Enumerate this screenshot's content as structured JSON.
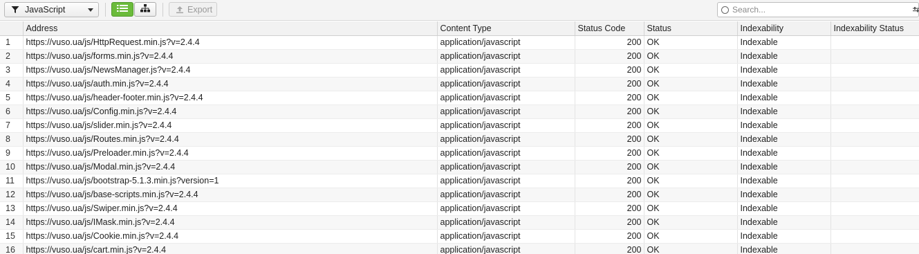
{
  "toolbar": {
    "filter_label": "JavaScript",
    "export_label": "Export",
    "search_placeholder": "Search...",
    "list_view_color": "#6bbb3b"
  },
  "table": {
    "columns": [
      "",
      "Address",
      "Content Type",
      "Status Code",
      "Status",
      "Indexability",
      "Indexability Status"
    ],
    "rows": [
      {
        "n": "1",
        "address": "https://vuso.ua/js/HttpRequest.min.js?v=2.4.4",
        "content_type": "application/javascript",
        "status_code": "200",
        "status": "OK",
        "indexability": "Indexable",
        "indexability_status": ""
      },
      {
        "n": "2",
        "address": "https://vuso.ua/js/forms.min.js?v=2.4.4",
        "content_type": "application/javascript",
        "status_code": "200",
        "status": "OK",
        "indexability": "Indexable",
        "indexability_status": ""
      },
      {
        "n": "3",
        "address": "https://vuso.ua/js/NewsManager.js?v=2.4.4",
        "content_type": "application/javascript",
        "status_code": "200",
        "status": "OK",
        "indexability": "Indexable",
        "indexability_status": ""
      },
      {
        "n": "4",
        "address": "https://vuso.ua/js/auth.min.js?v=2.4.4",
        "content_type": "application/javascript",
        "status_code": "200",
        "status": "OK",
        "indexability": "Indexable",
        "indexability_status": ""
      },
      {
        "n": "5",
        "address": "https://vuso.ua/js/header-footer.min.js?v=2.4.4",
        "content_type": "application/javascript",
        "status_code": "200",
        "status": "OK",
        "indexability": "Indexable",
        "indexability_status": ""
      },
      {
        "n": "6",
        "address": "https://vuso.ua/js/Config.min.js?v=2.4.4",
        "content_type": "application/javascript",
        "status_code": "200",
        "status": "OK",
        "indexability": "Indexable",
        "indexability_status": ""
      },
      {
        "n": "7",
        "address": "https://vuso.ua/js/slider.min.js?v=2.4.4",
        "content_type": "application/javascript",
        "status_code": "200",
        "status": "OK",
        "indexability": "Indexable",
        "indexability_status": ""
      },
      {
        "n": "8",
        "address": "https://vuso.ua/js/Routes.min.js?v=2.4.4",
        "content_type": "application/javascript",
        "status_code": "200",
        "status": "OK",
        "indexability": "Indexable",
        "indexability_status": ""
      },
      {
        "n": "9",
        "address": "https://vuso.ua/js/Preloader.min.js?v=2.4.4",
        "content_type": "application/javascript",
        "status_code": "200",
        "status": "OK",
        "indexability": "Indexable",
        "indexability_status": ""
      },
      {
        "n": "10",
        "address": "https://vuso.ua/js/Modal.min.js?v=2.4.4",
        "content_type": "application/javascript",
        "status_code": "200",
        "status": "OK",
        "indexability": "Indexable",
        "indexability_status": ""
      },
      {
        "n": "11",
        "address": "https://vuso.ua/js/bootstrap-5.1.3.min.js?version=1",
        "content_type": "application/javascript",
        "status_code": "200",
        "status": "OK",
        "indexability": "Indexable",
        "indexability_status": ""
      },
      {
        "n": "12",
        "address": "https://vuso.ua/js/base-scripts.min.js?v=2.4.4",
        "content_type": "application/javascript",
        "status_code": "200",
        "status": "OK",
        "indexability": "Indexable",
        "indexability_status": ""
      },
      {
        "n": "13",
        "address": "https://vuso.ua/js/Swiper.min.js?v=2.4.4",
        "content_type": "application/javascript",
        "status_code": "200",
        "status": "OK",
        "indexability": "Indexable",
        "indexability_status": ""
      },
      {
        "n": "14",
        "address": "https://vuso.ua/js/IMask.min.js?v=2.4.4",
        "content_type": "application/javascript",
        "status_code": "200",
        "status": "OK",
        "indexability": "Indexable",
        "indexability_status": ""
      },
      {
        "n": "15",
        "address": "https://vuso.ua/js/Cookie.min.js?v=2.4.4",
        "content_type": "application/javascript",
        "status_code": "200",
        "status": "OK",
        "indexability": "Indexable",
        "indexability_status": ""
      },
      {
        "n": "16",
        "address": "https://vuso.ua/js/cart.min.js?v=2.4.4",
        "content_type": "application/javascript",
        "status_code": "200",
        "status": "OK",
        "indexability": "Indexable",
        "indexability_status": ""
      }
    ]
  }
}
